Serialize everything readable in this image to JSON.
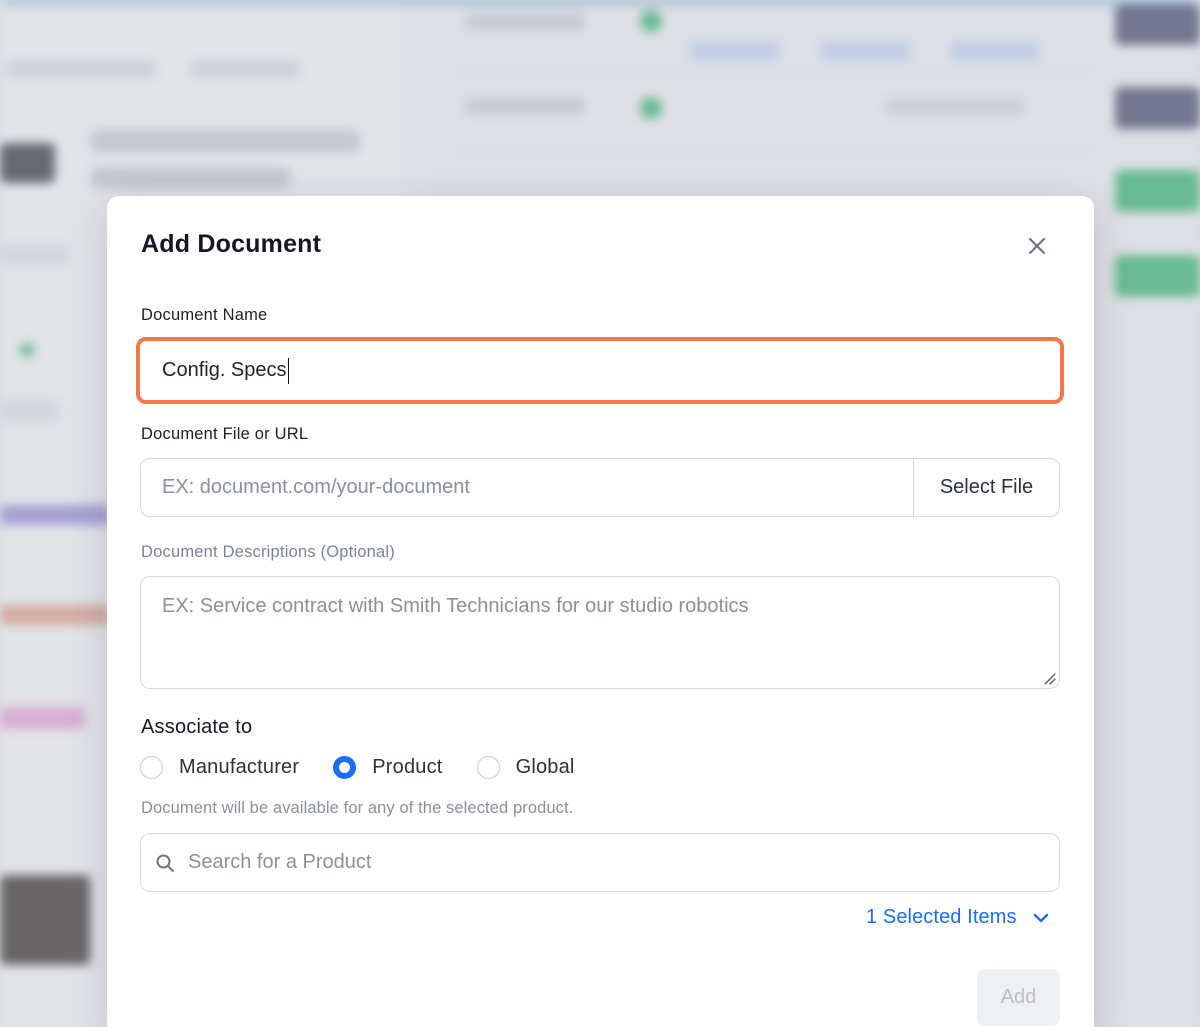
{
  "modal": {
    "title": "Add Document",
    "close_icon": "close-icon",
    "document_name": {
      "label": "Document Name",
      "value": "Config. Specs",
      "focus_color": "#f07a45"
    },
    "document_file": {
      "label": "Document File or URL",
      "placeholder": "EX: document.com/your-document",
      "select_file_label": "Select File"
    },
    "description": {
      "label": "Document Descriptions (Optional)",
      "placeholder": "EX: Service contract with Smith Technicians for our studio robotics"
    },
    "associate": {
      "title": "Associate to",
      "options": [
        {
          "label": "Manufacturer",
          "checked": false
        },
        {
          "label": "Product",
          "checked": true
        },
        {
          "label": "Global",
          "checked": false
        }
      ],
      "helper": "Document will be available for any of the selected product.",
      "search_placeholder": "Search for a Product",
      "search_icon": "search-icon",
      "selected_items_label": "1 Selected Items",
      "selected_items_icon": "chevron-down-icon"
    },
    "add_label": "Add"
  },
  "colors": {
    "accent": "#1b6ef3",
    "focus_border": "#f07a45",
    "disabled_button": "#eef0f3"
  }
}
